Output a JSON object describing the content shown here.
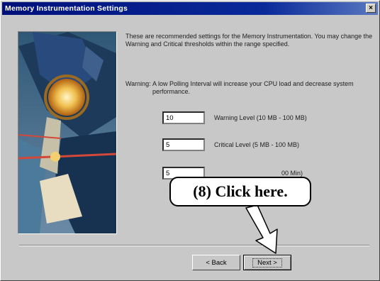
{
  "window": {
    "title": "Memory Instrumentation Settings",
    "close_symbol": "×"
  },
  "intro_text": "These are recommended settings for the Memory Instrumentation. You may change the Warning and Critical thresholds within the range specified.",
  "warning": {
    "label": "Warning:",
    "text": "A low Polling Interval will increase your CPU load and decrease system performance."
  },
  "fields": [
    {
      "value": "10",
      "label": "Warning Level (10 MB - 100 MB)"
    },
    {
      "value": "5",
      "label": "Critical  Level (5 MB - 100 MB)"
    },
    {
      "value": "5",
      "label": "00 Min)"
    }
  ],
  "buttons": {
    "back": "< Back",
    "next": "Next >"
  },
  "callout": {
    "text": "(8)  Click here."
  }
}
